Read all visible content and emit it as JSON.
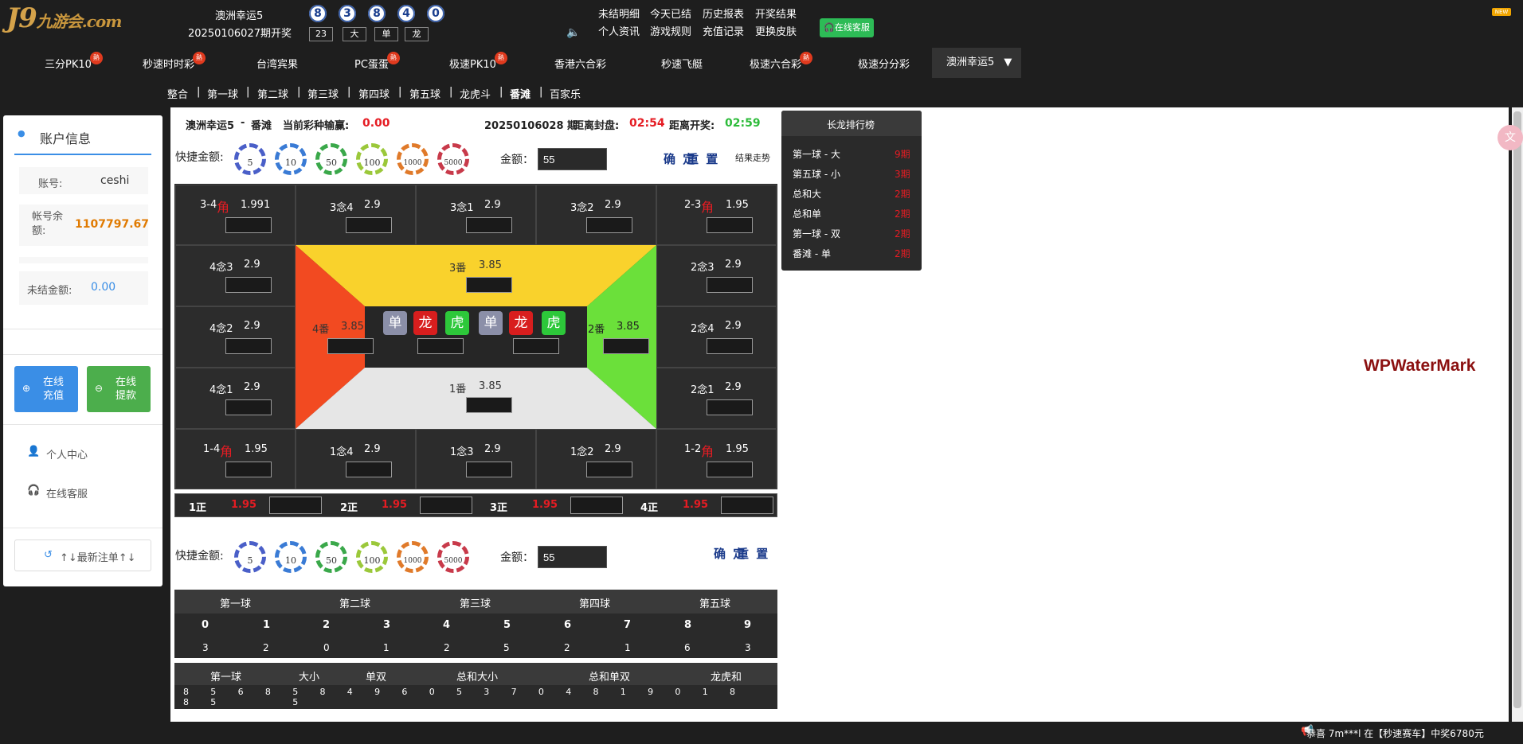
{
  "header": {
    "logo_main": "J9",
    "logo_sub": "九游会.com",
    "lottery_name": "澳洲幸运5",
    "draw_no": "20250106027期开奖",
    "balls": [
      "8",
      "3",
      "8",
      "4",
      "0"
    ],
    "tags": [
      "23",
      "大",
      "单",
      "龙"
    ],
    "links_row1": [
      "未结明细",
      "今天已结",
      "历史报表",
      "开奖结果"
    ],
    "links_row2": [
      "个人资讯",
      "游戏规则",
      "充值记录",
      "更换皮肤"
    ],
    "service_label": "在线客服",
    "new_badge": "NEW"
  },
  "nav": {
    "items": [
      {
        "label": "三分PK10",
        "hot": true
      },
      {
        "label": "秒速时时彩",
        "hot": true
      },
      {
        "label": "台湾宾果",
        "hot": false
      },
      {
        "label": "PC蛋蛋",
        "hot": true
      },
      {
        "label": "极速PK10",
        "hot": true
      },
      {
        "label": "香港六合彩",
        "hot": false
      },
      {
        "label": "秒速飞艇",
        "hot": false
      },
      {
        "label": "极速六合彩",
        "hot": true
      },
      {
        "label": "极速分分彩",
        "hot": false
      }
    ],
    "active": "澳洲幸运5",
    "hot_label": "熱"
  },
  "subnav": [
    "整合",
    "第一球",
    "第二球",
    "第三球",
    "第四球",
    "第五球",
    "龙虎斗",
    "番滩",
    "百家乐"
  ],
  "sidebar": {
    "title": "账户信息",
    "account_label": "账号:",
    "account_value": "ceshi",
    "balance_label": "帐号余额:",
    "balance_value": "1107797.67",
    "unsettled_label": "未结金额:",
    "unsettled_value": "0.00",
    "deposit_label": "在线充值",
    "withdraw_label": "在线提款",
    "personal_label": "个人中心",
    "service_label": "在线客服",
    "latest_label": "↑↓最新注单↑↓"
  },
  "status": {
    "lottery": "澳洲幸运5",
    "sep": "-",
    "mode": "番滩",
    "pl_label": "当前彩种输赢:",
    "pl_value": "0.00",
    "period": "20250106028 期",
    "close_label": "距离封盘:",
    "close_time": "02:54",
    "open_label": "距离开奖:",
    "open_time": "02:59"
  },
  "bet": {
    "quick_label": "快捷金额:",
    "chips": [
      "5",
      "10",
      "50",
      "100",
      "1000",
      "5000"
    ],
    "amount_label": "金额：",
    "amount_value": "55",
    "confirm": "确 定",
    "reset": "重 置",
    "trend": "结果走势"
  },
  "grid": {
    "top_row": [
      {
        "name": "3-4",
        "jiao": true,
        "odds": "1.991"
      },
      {
        "name": "3念4",
        "jiao": false,
        "odds": "2.9"
      },
      {
        "name": "3念1",
        "jiao": false,
        "odds": "2.9"
      },
      {
        "name": "3念2",
        "jiao": false,
        "odds": "2.9"
      },
      {
        "name": "2-3",
        "jiao": true,
        "odds": "1.95"
      }
    ],
    "left_col": [
      {
        "name": "4念3",
        "odds": "2.9"
      },
      {
        "name": "4念2",
        "odds": "2.9"
      },
      {
        "name": "4念1",
        "odds": "2.9"
      }
    ],
    "right_col": [
      {
        "name": "2念3",
        "odds": "2.9"
      },
      {
        "name": "2念4",
        "odds": "2.9"
      },
      {
        "name": "2念1",
        "odds": "2.9"
      }
    ],
    "bottom_row": [
      {
        "name": "1-4",
        "jiao": true,
        "odds": "1.95"
      },
      {
        "name": "1念4",
        "jiao": false,
        "odds": "2.9"
      },
      {
        "name": "1念3",
        "jiao": false,
        "odds": "2.9"
      },
      {
        "name": "1念2",
        "jiao": false,
        "odds": "2.9"
      },
      {
        "name": "1-2",
        "jiao": true,
        "odds": "1.95"
      }
    ],
    "jiao_char": "角",
    "fan3": {
      "name": "3番",
      "odds": "3.85"
    },
    "fan4": {
      "name": "4番",
      "odds": "3.85"
    },
    "fan2": {
      "name": "2番",
      "odds": "3.85"
    },
    "fan1": {
      "name": "1番",
      "odds": "3.85"
    },
    "center_tags": [
      "单",
      "龙",
      "虎",
      "单",
      "龙",
      "虎"
    ],
    "zheng": [
      {
        "name": "1正",
        "odds": "1.95"
      },
      {
        "name": "2正",
        "odds": "1.95"
      },
      {
        "name": "3正",
        "odds": "1.95"
      },
      {
        "name": "4正",
        "odds": "1.95"
      }
    ]
  },
  "changlong": {
    "title": "长龙排行榜",
    "rows": [
      {
        "name": "第一球 - 大",
        "value": "9期"
      },
      {
        "name": "第五球 - 小",
        "value": "3期"
      },
      {
        "name": "总和大",
        "value": "2期"
      },
      {
        "name": "总和单",
        "value": "2期"
      },
      {
        "name": "第一球 - 双",
        "value": "2期"
      },
      {
        "name": "番滩 - 单",
        "value": "2期"
      }
    ]
  },
  "stats": {
    "balls_header": [
      "第一球",
      "第二球",
      "第三球",
      "第四球",
      "第五球"
    ],
    "digits": [
      "0",
      "1",
      "2",
      "3",
      "4",
      "5",
      "6",
      "7",
      "8",
      "9"
    ],
    "counts": [
      "3",
      "2",
      "0",
      "1",
      "2",
      "5",
      "2",
      "1",
      "6",
      "3"
    ]
  },
  "trend": {
    "headers": [
      "第一球",
      "大小",
      "单双",
      "总和大小",
      "总和单双",
      "龙虎和"
    ],
    "row1": [
      "8",
      "5",
      "6",
      "8",
      "5",
      "8",
      "4",
      "9",
      "6",
      "0",
      "5",
      "3",
      "7",
      "0",
      "4",
      "8",
      "1",
      "9",
      "0",
      "1",
      "8"
    ],
    "row2": [
      "8",
      "5",
      "",
      "",
      "5"
    ]
  },
  "watermark": "WPWaterMark",
  "ticker": "恭喜 7m***l 在【秒速赛车】中奖6780元",
  "colors": {
    "red": "#e51c23",
    "green": "#2dbb3a",
    "orange": "#e07a00",
    "blue": "#3a8ee6"
  }
}
